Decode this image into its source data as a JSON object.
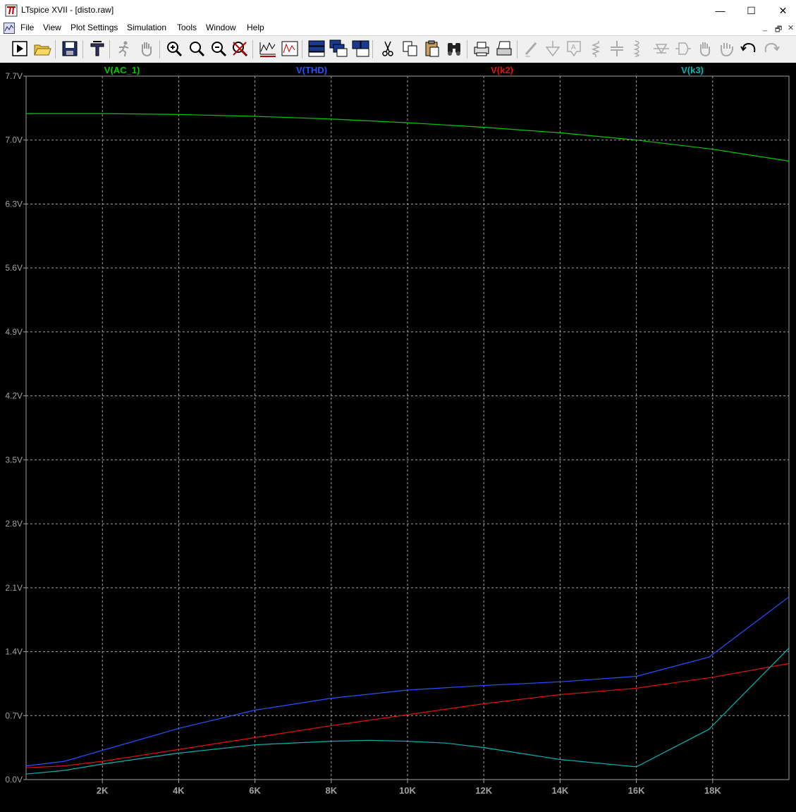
{
  "window": {
    "title": "LTspice XVII - [disto.raw]",
    "minimize_glyph": "—",
    "maximize_glyph": "☐",
    "close_glyph": "✕",
    "mdi_minimize_glyph": "_",
    "mdi_restore_glyph": "🗗",
    "mdi_close_glyph": "✕"
  },
  "menu": [
    {
      "label": "File"
    },
    {
      "label": "View"
    },
    {
      "label": "Plot Settings"
    },
    {
      "label": "Simulation"
    },
    {
      "label": "Tools"
    },
    {
      "label": "Window"
    },
    {
      "label": "Help"
    }
  ],
  "toolbar": [
    {
      "icon": "run-icon"
    },
    {
      "icon": "open-icon"
    },
    {
      "icon": "save-icon"
    },
    {
      "icon": "control-panel-icon"
    },
    {
      "icon": "halt-icon"
    },
    {
      "icon": "pan-icon"
    },
    {
      "icon": "zoom-in-icon"
    },
    {
      "icon": "zoom-full-icon"
    },
    {
      "icon": "zoom-out-icon"
    },
    {
      "icon": "zoom-cancel-icon"
    },
    {
      "icon": "autorange-icon"
    },
    {
      "icon": "fft-icon"
    },
    {
      "icon": "tile-horizontal-icon"
    },
    {
      "icon": "cascade-icon"
    },
    {
      "icon": "tile-vertical-icon"
    },
    {
      "icon": "cut-icon"
    },
    {
      "icon": "copy-icon"
    },
    {
      "icon": "paste-icon"
    },
    {
      "icon": "find-icon"
    },
    {
      "icon": "print-preview-icon"
    },
    {
      "icon": "print-icon"
    },
    {
      "icon": "wire-icon"
    },
    {
      "icon": "ground-icon"
    },
    {
      "icon": "label-icon"
    },
    {
      "icon": "resistor-icon"
    },
    {
      "icon": "capacitor-icon"
    },
    {
      "icon": "inductor-icon"
    },
    {
      "icon": "diode-icon"
    },
    {
      "icon": "component-icon"
    },
    {
      "icon": "move-icon"
    },
    {
      "icon": "drag-icon"
    },
    {
      "icon": "undo-icon"
    },
    {
      "icon": "redo-icon"
    }
  ],
  "colors": {
    "plot_background": "#000000",
    "grid": "#a0a0a0",
    "axis_text": "#a0a0a0",
    "ac1": "#00c800",
    "thd": "#2850ff",
    "k2": "#e01010",
    "k3": "#00b4b4"
  },
  "chart_data": {
    "type": "line",
    "grid": true,
    "xlim": [
      0,
      20000
    ],
    "ylim": [
      0,
      7.7
    ],
    "x_ticks": [
      {
        "v": 2000,
        "label": "2K"
      },
      {
        "v": 4000,
        "label": "4K"
      },
      {
        "v": 6000,
        "label": "6K"
      },
      {
        "v": 8000,
        "label": "8K"
      },
      {
        "v": 10000,
        "label": "10K"
      },
      {
        "v": 12000,
        "label": "12K"
      },
      {
        "v": 14000,
        "label": "14K"
      },
      {
        "v": 16000,
        "label": "16K"
      },
      {
        "v": 18000,
        "label": "18K"
      }
    ],
    "y_ticks": [
      {
        "v": 0.0,
        "label": "0.0V"
      },
      {
        "v": 0.7,
        "label": "0.7V"
      },
      {
        "v": 1.4,
        "label": "1.4V"
      },
      {
        "v": 2.1,
        "label": "2.1V"
      },
      {
        "v": 2.8,
        "label": "2.8V"
      },
      {
        "v": 3.5,
        "label": "3.5V"
      },
      {
        "v": 4.2,
        "label": "4.2V"
      },
      {
        "v": 4.9,
        "label": "4.9V"
      },
      {
        "v": 5.6,
        "label": "5.6V"
      },
      {
        "v": 6.3,
        "label": "6.3V"
      },
      {
        "v": 7.0,
        "label": "7.0V"
      },
      {
        "v": 7.7,
        "label": "7.7V"
      }
    ],
    "series": [
      {
        "name": "V(AC_1)",
        "color": "#00c800",
        "x": [
          0,
          2000,
          4000,
          6000,
          8000,
          10000,
          12000,
          14000,
          16000,
          18000,
          20000
        ],
        "y": [
          7.29,
          7.29,
          7.28,
          7.26,
          7.23,
          7.19,
          7.14,
          7.08,
          7.0,
          6.9,
          6.77
        ]
      },
      {
        "name": "V(THD)",
        "color": "#2850ff",
        "x": [
          0,
          1000,
          2000,
          4000,
          6000,
          8000,
          10000,
          12000,
          14000,
          16000,
          17900,
          20000
        ],
        "y": [
          0.15,
          0.2,
          0.32,
          0.56,
          0.76,
          0.89,
          0.98,
          1.03,
          1.07,
          1.13,
          1.34,
          2.0
        ]
      },
      {
        "name": "V(k2)",
        "color": "#e01010",
        "x": [
          0,
          1000,
          2000,
          4000,
          6000,
          8000,
          10000,
          12000,
          14000,
          16000,
          18000,
          20000
        ],
        "y": [
          0.13,
          0.15,
          0.2,
          0.33,
          0.46,
          0.59,
          0.71,
          0.83,
          0.93,
          1.0,
          1.12,
          1.27
        ]
      },
      {
        "name": "V(k3)",
        "color": "#00b4b4",
        "x": [
          0,
          1000,
          2000,
          4000,
          6000,
          8000,
          9000,
          10000,
          11000,
          12000,
          14000,
          16000,
          17900,
          20000
        ],
        "y": [
          0.06,
          0.1,
          0.17,
          0.29,
          0.38,
          0.42,
          0.43,
          0.42,
          0.4,
          0.35,
          0.22,
          0.14,
          0.55,
          1.44
        ]
      }
    ]
  }
}
